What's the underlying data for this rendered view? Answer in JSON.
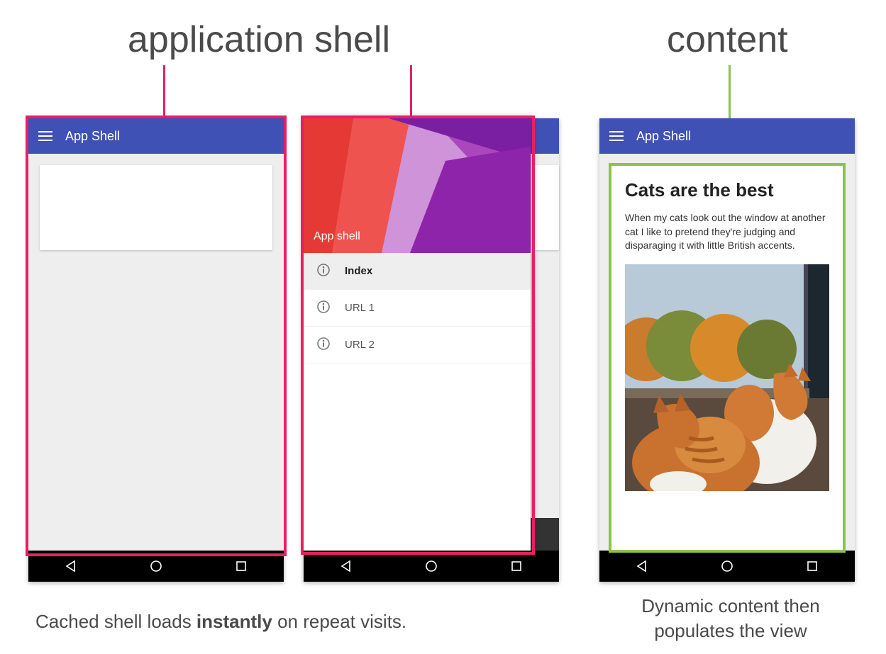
{
  "labels": {
    "heading_left": "application shell",
    "heading_right": "content"
  },
  "captions": {
    "left_pre": "Cached shell loads ",
    "left_bold": "instantly",
    "left_post": " on repeat visits.",
    "right_line1": "Dynamic content then",
    "right_line2": "populates the view"
  },
  "appbar": {
    "title": "App Shell"
  },
  "drawer": {
    "hero_label": "App shell",
    "items": [
      {
        "label": "Index",
        "selected": true
      },
      {
        "label": "URL 1",
        "selected": false
      },
      {
        "label": "URL 2",
        "selected": false
      }
    ]
  },
  "content": {
    "title": "Cats are the best",
    "body": "When my cats look out the window at another cat I like to pretend they're judging and disparaging it with little British accents."
  },
  "colors": {
    "highlight_pink": "#e91e63",
    "highlight_green": "#8bc34a",
    "appbar": "#3f51b5"
  }
}
